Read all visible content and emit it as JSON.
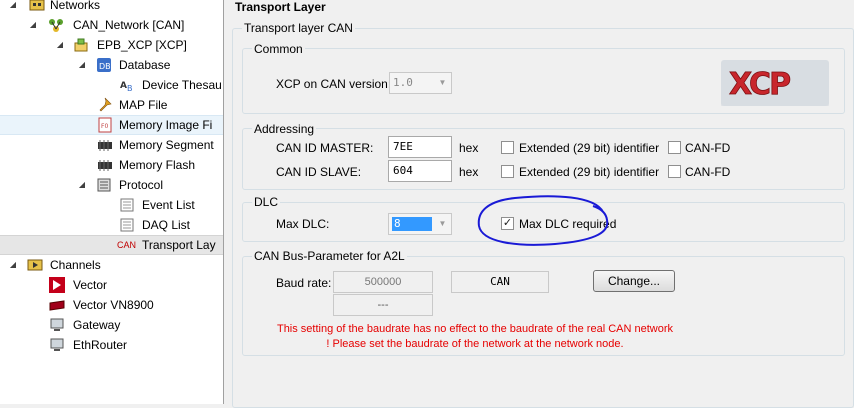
{
  "tree": {
    "networks": "Networks",
    "can_network": "CAN_Network [CAN]",
    "epb_xcp": "EPB_XCP [XCP]",
    "database": "Database",
    "device_thesaurus": "Device Thesau",
    "map_file": "MAP File",
    "memory_image": "Memory Image Fi",
    "memory_segments": "Memory Segment",
    "memory_flash": "Memory Flash",
    "protocol": "Protocol",
    "event_list": "Event List",
    "daq_list": "DAQ List",
    "can_tag": "CAN",
    "transport_layer": "Transport Lay",
    "channels": "Channels",
    "vector": "Vector",
    "vector_vn8900": "Vector VN8900",
    "gateway": "Gateway",
    "ethrouter": "EthRouter"
  },
  "panel": {
    "title": "Transport Layer",
    "outer_group": "Transport layer CAN",
    "logo_text": "XCP",
    "common": {
      "title": "Common",
      "version_label": "XCP on CAN version:",
      "version_value": "1.0"
    },
    "addressing": {
      "title": "Addressing",
      "master_label": "CAN ID MASTER:",
      "master_value": "7EE",
      "slave_label": "CAN ID SLAVE:",
      "slave_value": "604",
      "hex": "hex",
      "extended_label": "Extended (29 bit) identifier",
      "canfd_label": "CAN-FD"
    },
    "dlc": {
      "title": "DLC",
      "max_dlc_label": "Max DLC:",
      "max_dlc_value": "8",
      "required_label": "Max DLC required",
      "required_checked": true
    },
    "busparam": {
      "title": "CAN Bus-Parameter for A2L",
      "baud_label": "Baud rate:",
      "baud_value": "500000",
      "baud_type": "CAN",
      "secondary": "---",
      "change_button": "Change...",
      "warning": "This setting of the baudrate has no effect to the baudrate of the real CAN network ! Please set the baudrate of the network at the network node."
    }
  },
  "colors": {
    "annotation_circle": "#1a1ad6",
    "warning_text": "#e60000",
    "group_border": "#d5dfe5"
  }
}
